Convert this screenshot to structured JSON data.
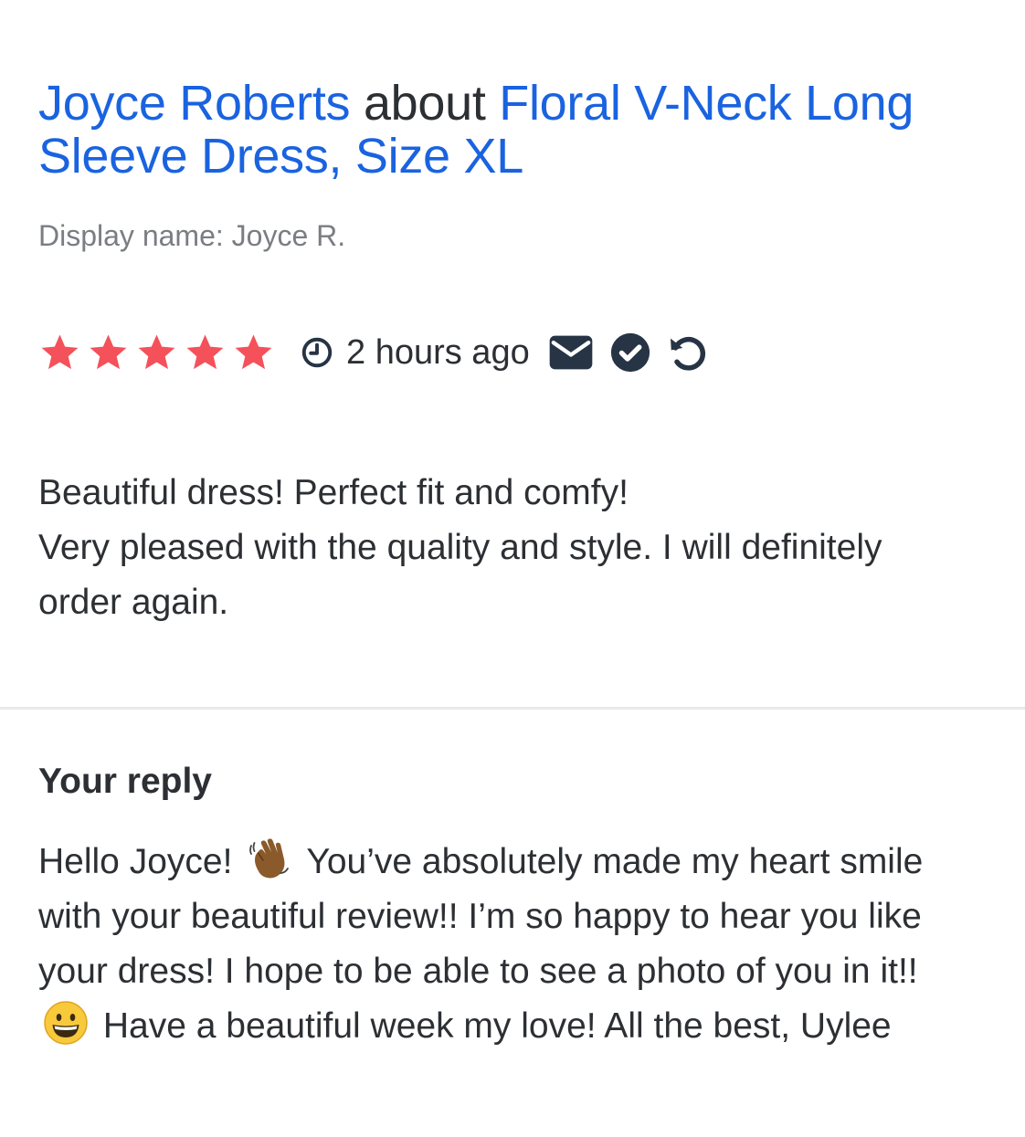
{
  "review": {
    "author": "Joyce Roberts",
    "about_word": "about",
    "product": "Floral V-Neck Long Sleeve Dress, Size XL",
    "display_name": "Display name: Joyce R.",
    "rating": 5,
    "rating_max": 5,
    "time_ago": "2 hours ago",
    "body_line1": "Beautiful dress! Perfect fit and comfy!",
    "body_line2": "Very pleased with the quality and style. I will definitely order again."
  },
  "reply": {
    "title": "Your reply",
    "part1": "Hello Joyce!",
    "emoji1": "waving-hand-emoji",
    "part2": "You’ve absolutely made my heart smile with your beautiful review!! I’m so happy to hear you like your dress! I hope to be able to see a photo of you in it!!",
    "emoji2": "grinning-face-emoji",
    "part3": "Have a beautiful week my love! All the best, Uylee"
  },
  "colors": {
    "link": "#1a63e0",
    "star": "#f4515a",
    "text": "#2c2f33",
    "muted": "#7a7d82",
    "icon": "#263445"
  },
  "icons": [
    "star-icon",
    "clock-icon",
    "envelope-icon",
    "check-circle-icon",
    "undo-icon"
  ]
}
